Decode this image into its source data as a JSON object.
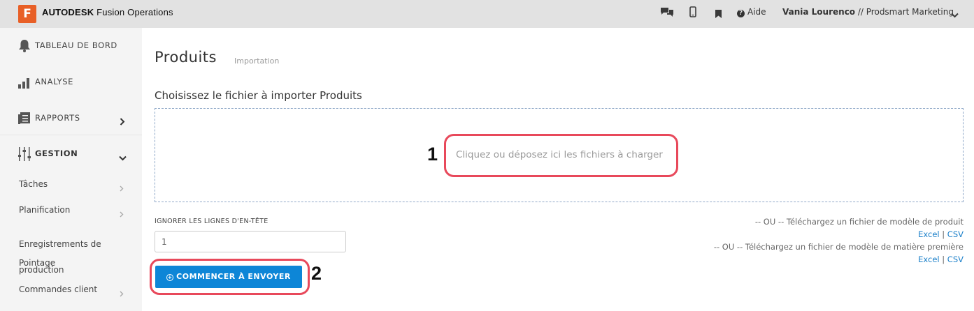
{
  "header": {
    "logo_letter": "F",
    "brand_bold": "AUTODESK",
    "brand_rest": " Fusion Operations",
    "help_label": "Aide",
    "user_name": "Vania Lourenco",
    "user_org": " // Prodsmart Marketing",
    "icons": [
      "chat-icon",
      "mobile-icon",
      "bookmark-icon",
      "help-icon",
      "chevron-down-icon"
    ]
  },
  "sidebar": {
    "items": [
      {
        "label": "TABLEAU DE BORD",
        "icon": "bell-icon"
      },
      {
        "label": "ANALYSE",
        "icon": "bar-chart-icon"
      },
      {
        "label": "RAPPORTS",
        "icon": "reports-icon"
      },
      {
        "label": "GESTION",
        "icon": "sliders-icon"
      }
    ],
    "sub_items": [
      {
        "label": "Tâches"
      },
      {
        "label": "Planification"
      },
      {
        "label": "Enregistrements de production"
      },
      {
        "label": "Pointage"
      },
      {
        "label": "Commandes client"
      }
    ]
  },
  "main": {
    "title": "Produits",
    "subtitle": "Importation",
    "section_title": "Choisissez le fichier à importer Produits",
    "dropzone_text": "Cliquez ou déposez ici les fichiers à charger",
    "header_lines_label": "IGNORER LES LIGNES D'EN-TÊTE",
    "header_lines_value": "1",
    "start_button": "COMMENCER À ENVOYER",
    "product_template_text": "-- OU -- Téléchargez un fichier de modèle de produit",
    "material_template_text": "-- OU -- Téléchargez un fichier de modèle de matière première",
    "link_excel": "Excel",
    "link_separator": " | ",
    "link_csv": "CSV"
  },
  "annotations": {
    "marker_1": "1",
    "marker_2": "2",
    "highlight_color": "#e8495b"
  },
  "colors": {
    "accent": "#0d86d7",
    "brand_orange": "#e85f26",
    "link": "#1a7fc9"
  }
}
